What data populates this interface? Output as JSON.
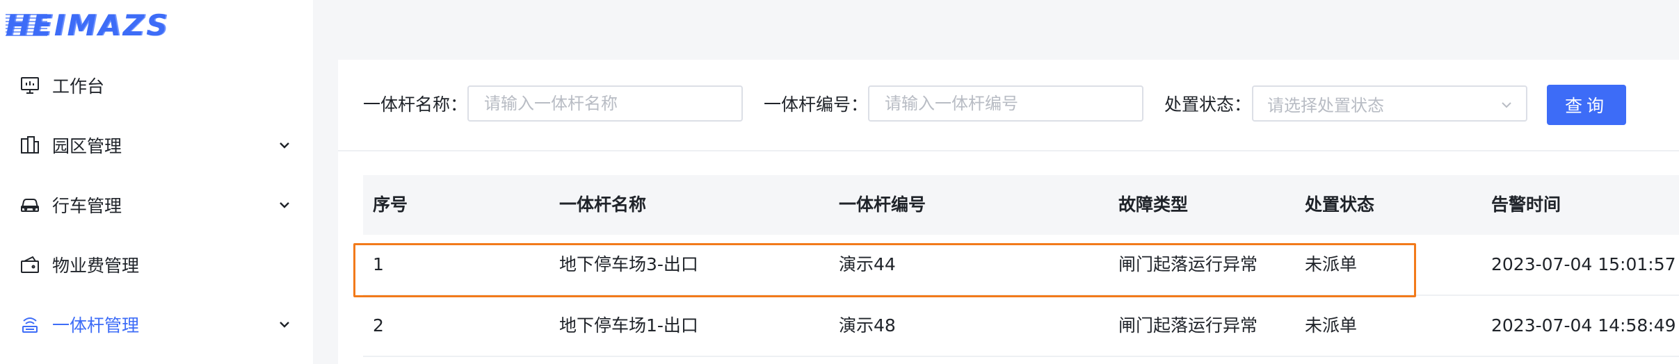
{
  "logo": {
    "text": "HEIMAZS"
  },
  "sidebar": {
    "items": [
      {
        "label": "工作台",
        "icon": "monitor-icon",
        "has_chevron": false,
        "active": false
      },
      {
        "label": "园区管理",
        "icon": "building-icon",
        "has_chevron": true,
        "active": false
      },
      {
        "label": "行车管理",
        "icon": "car-icon",
        "has_chevron": true,
        "active": false
      },
      {
        "label": "物业费管理",
        "icon": "wallet-icon",
        "has_chevron": false,
        "active": false
      },
      {
        "label": "一体杆管理",
        "icon": "signal-pole-icon",
        "has_chevron": true,
        "active": true
      }
    ]
  },
  "filters": {
    "name_label": "一体杆名称：",
    "name_placeholder": "请输入一体杆名称",
    "code_label": "一体杆编号：",
    "code_placeholder": "请输入一体杆编号",
    "status_label": "处置状态：",
    "status_placeholder": "请选择处置状态",
    "query_button": "查询"
  },
  "table": {
    "columns": [
      "序号",
      "一体杆名称",
      "一体杆编号",
      "故障类型",
      "处置状态",
      "告警时间"
    ],
    "rows": [
      [
        "1",
        "地下停车场3-出口",
        "演示44",
        "闸门起落运行异常",
        "未派单",
        "2023-07-04 15:01:57"
      ],
      [
        "2",
        "地下停车场1-出口",
        "演示48",
        "闸门起落运行异常",
        "未派单",
        "2023-07-04 14:58:49"
      ]
    ]
  },
  "colors": {
    "accent": "#3d6cf7",
    "highlight_border": "#f27a1a"
  }
}
